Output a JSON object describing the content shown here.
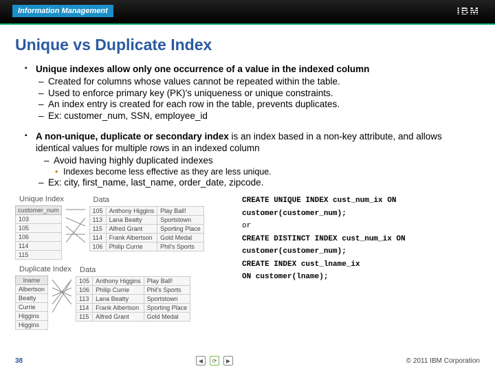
{
  "topbar": {
    "brand": "Information Management",
    "logo": "IBM"
  },
  "title": "Unique vs Duplicate Index",
  "bullets": {
    "b1": "Unique indexes allow only one occurrence of a value in the indexed column",
    "b1s1": "Created for columns whose values cannot be repeated within the table.",
    "b1s2": "Used to enforce primary key (PK)'s uniqueness or unique constraints.",
    "b1s3": "An index entry is created for each row in the table, prevents duplicates.",
    "b1s4": "Ex: customer_num, SSN, employee_id",
    "b2_lead": "A non-unique, duplicate or secondary index",
    "b2_rest": " is an index based in a non-key attribute, and allows identical values for multiple rows in an indexed column",
    "b2s1": "Avoid having highly duplicated indexes",
    "b2s1a": "Indexes become less effective as they are less unique.",
    "b2s2": "Ex: city, first_name, last_name, order_date, zipcode."
  },
  "diagram": {
    "label_unique": "Unique Index",
    "label_dup": "Duplicate Index",
    "idx_unique_header": "customer_num",
    "idx_unique": [
      "103",
      "105",
      "106",
      "114",
      "115"
    ],
    "idx_dup_header": "lname",
    "idx_dup": [
      "Albertson",
      "Beatty",
      "Currie",
      "Higgins",
      "Higgins"
    ],
    "data_label": "Data",
    "data_rows": [
      {
        "id": "105",
        "name": "Anthony Higgins",
        "co": "Play Ball!"
      },
      {
        "id": "113",
        "name": "Lana Beatty",
        "co": "Sportstown"
      },
      {
        "id": "115",
        "name": "Alfred Grant",
        "co": "Sporting Place"
      },
      {
        "id": "114",
        "name": "Frank Albertson",
        "co": "Gold Medal"
      },
      {
        "id": "106",
        "name": "Philip Currie",
        "co": "Phil's Sports"
      }
    ],
    "data_rows2": [
      {
        "id": "105",
        "name": "Anthony Higgins",
        "co": "Play Ball!"
      },
      {
        "id": "106",
        "name": "Philip Currie",
        "co": "Phil's Sports"
      },
      {
        "id": "113",
        "name": "Lana Beatty",
        "co": "Sportstown"
      },
      {
        "id": "114",
        "name": "Frank Albertson",
        "co": "Sporting Place"
      },
      {
        "id": "115",
        "name": "Alfred Grant",
        "co": "Gold Medal"
      }
    ]
  },
  "sql": {
    "l1": "CREATE UNIQUE INDEX cust_num_ix ON",
    "l2": "customer(customer_num);",
    "l3": "or",
    "l4": "CREATE DISTINCT INDEX cust_num_ix ON",
    "l5": "customer(customer_num);",
    "l6": "CREATE INDEX cust_lname_ix",
    "l7": "ON customer(lname);"
  },
  "footer": {
    "slide": "38",
    "copyright": "© 2011 IBM Corporation"
  }
}
